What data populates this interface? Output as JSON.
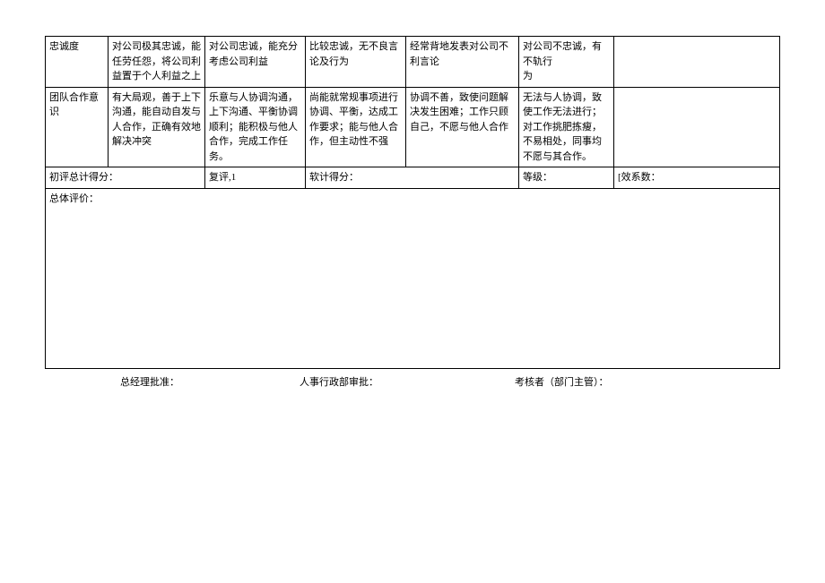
{
  "rows": [
    {
      "label": "忠诚度",
      "c1": "对公司极其忠诚，能任劳任怨，将公司利益置于个人利益之上",
      "c2": "对公司忠诚，能充分考虑公司利益",
      "c3": "比较忠诚，无不良言论及行为",
      "c4": "经常背地发表对公司不利言论",
      "c5": "对公司不忠诚，有不轨行\n为",
      "c6": ""
    },
    {
      "label": "团队合作意识",
      "c1": "有大局观，善于上下沟通，能自动自发与人合作，正确有效地解决冲突",
      "c2": "乐意与人协调沟通，上下沟通、平衡协调顺利；能积极与他人合作，完成工作任务。",
      "c3": "尚能就常规事项进行协调、平衡，达成工作要求；能与他人合作，但主动性不强",
      "c4": "协调不善，致使问题解决发生困难；工作只顾自己，不愿与他人合作",
      "c5": "无法与人协调，致使工作无法进行；对工作挑肥拣瘦，不易相处，同事均不愿与其合作。",
      "c6": ""
    }
  ],
  "summary": {
    "s0": "初评总计得分：",
    "s1": "复评,1",
    "s2": "软计得分：",
    "s3": "等级：",
    "s4": "[效系数："
  },
  "eval_label": "总体评价：",
  "signoff": {
    "gm": "总经理批准：",
    "hr": "人事行政部审批：",
    "assessor": "考核者（部门主管）："
  }
}
